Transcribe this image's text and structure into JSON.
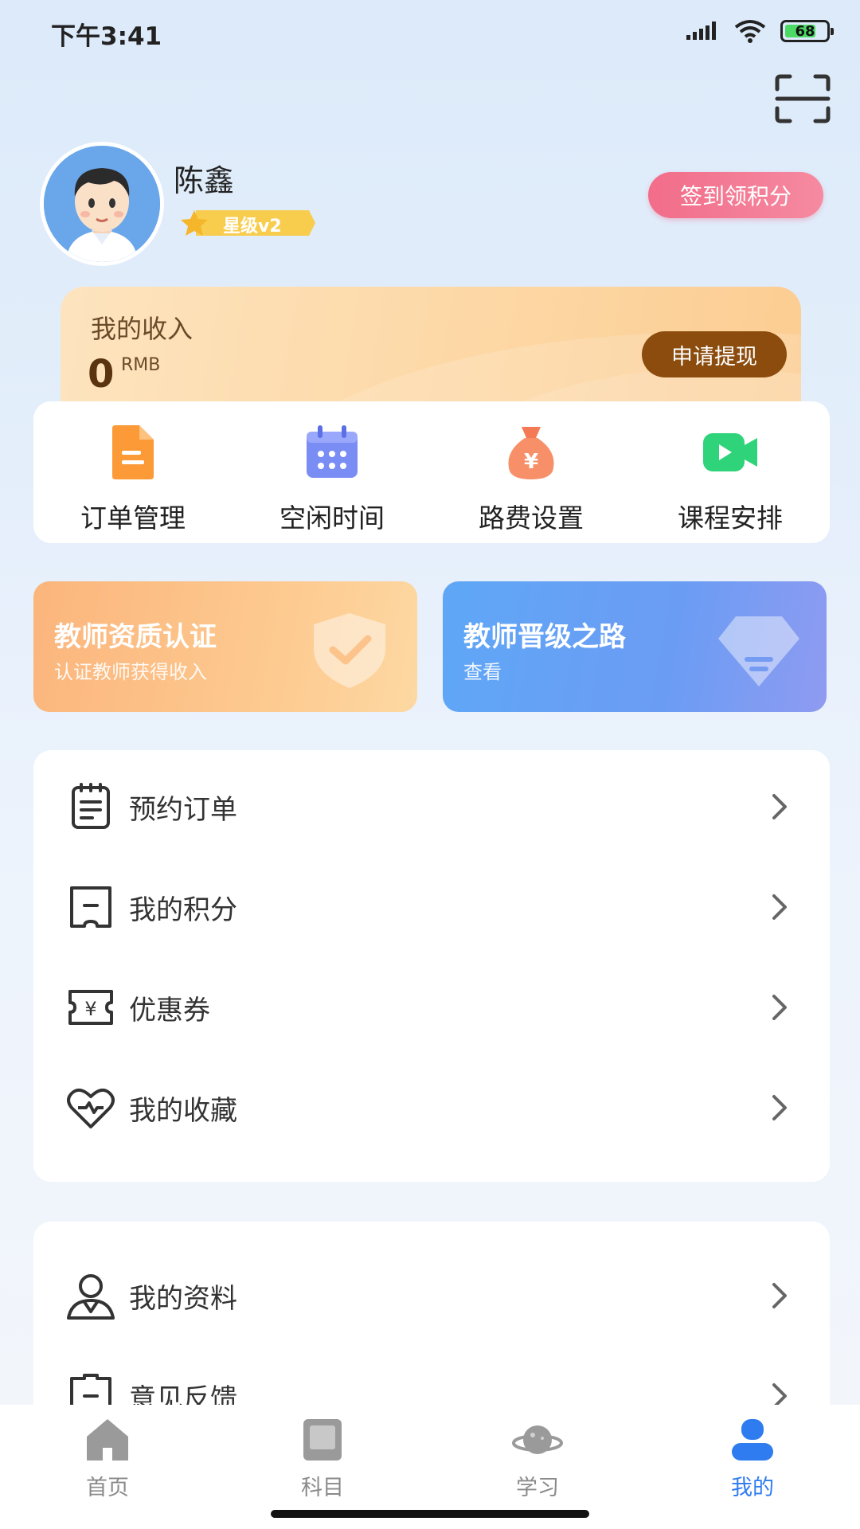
{
  "status": {
    "time": "下午3:41",
    "battery": "68"
  },
  "profile": {
    "name": "陈鑫",
    "level": "星级v2",
    "signin_label": "签到领积分"
  },
  "income": {
    "title": "我的收入",
    "value": "0",
    "unit": "RMB",
    "withdraw_label": "申请提现"
  },
  "quick_actions": [
    {
      "label": "订单管理",
      "icon": "order-icon"
    },
    {
      "label": "空闲时间",
      "icon": "calendar-icon"
    },
    {
      "label": "路费设置",
      "icon": "money-bag-icon"
    },
    {
      "label": "课程安排",
      "icon": "video-icon"
    }
  ],
  "banners": [
    {
      "title": "教师资质认证",
      "subtitle": "认证教师获得收入"
    },
    {
      "title": "教师晋级之路",
      "subtitle": "查看"
    }
  ],
  "menu": [
    {
      "label": "预约订单",
      "icon": "clipboard-icon"
    },
    {
      "label": "我的积分",
      "icon": "points-card-icon"
    },
    {
      "label": "优惠券",
      "icon": "coupon-icon"
    },
    {
      "label": "我的收藏",
      "icon": "heart-icon"
    }
  ],
  "menu2": [
    {
      "label": "我的资料",
      "icon": "user-icon"
    },
    {
      "label": "意见反馈",
      "icon": "feedback-icon"
    }
  ],
  "tabs": [
    {
      "label": "首页",
      "icon": "home-icon"
    },
    {
      "label": "科目",
      "icon": "book-icon"
    },
    {
      "label": "学习",
      "icon": "planet-icon"
    },
    {
      "label": "我的",
      "icon": "profile-icon",
      "active": true
    }
  ],
  "colors": {
    "accent": "#2f7cf0",
    "signin": "#f26d8a",
    "withdraw": "#8b4c0e"
  }
}
